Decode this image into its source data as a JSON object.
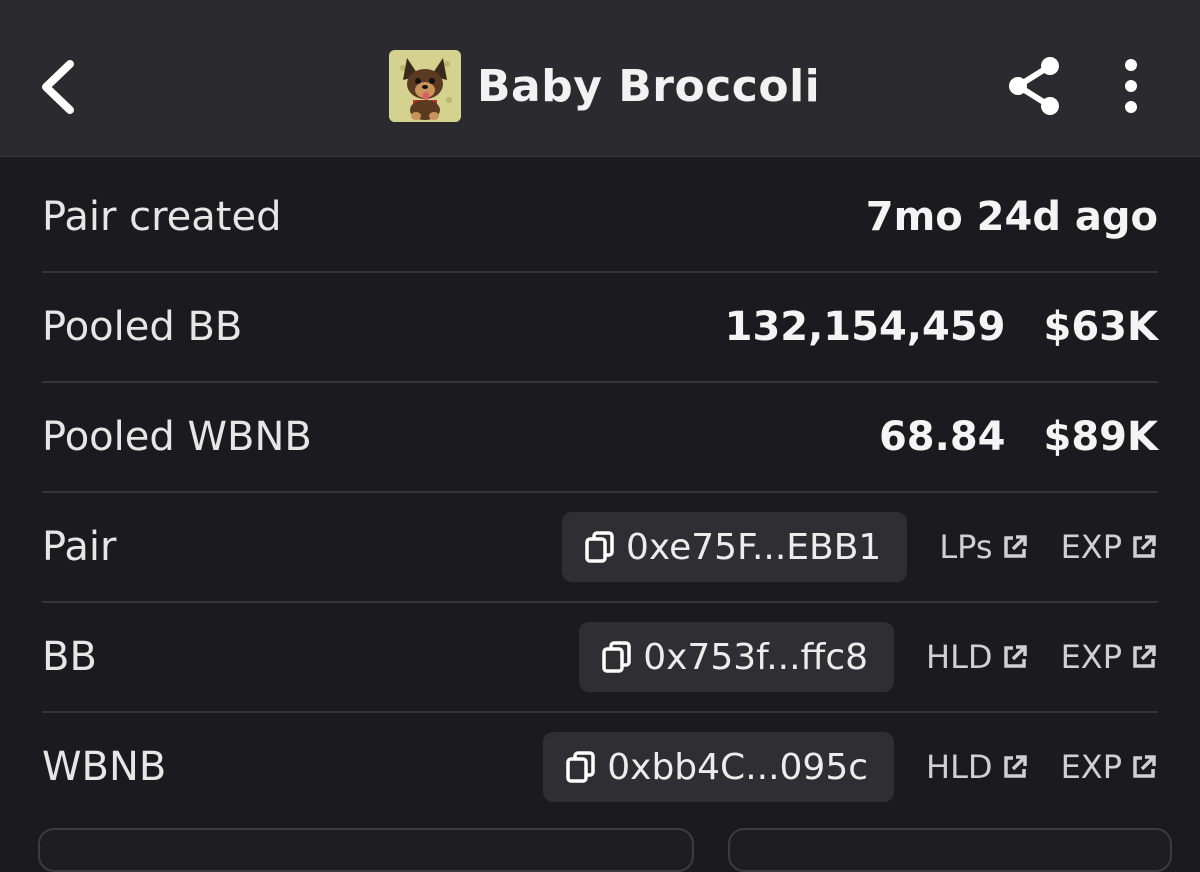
{
  "header": {
    "title": "Baby Broccoli",
    "back_icon": "chevron-left-icon",
    "share_icon": "share-icon",
    "more_icon": "more-vertical-icon"
  },
  "rows": {
    "pair_created": {
      "label": "Pair created",
      "value": "7mo 24d ago"
    },
    "pooled_bb": {
      "label": "Pooled BB",
      "amount": "132,154,459",
      "usd": "$63K"
    },
    "pooled_wbnb": {
      "label": "Pooled WBNB",
      "amount": "68.84",
      "usd": "$89K"
    },
    "pair": {
      "label": "Pair",
      "address": "0xe75F...EBB1",
      "link1": "LPs",
      "link2": "EXP"
    },
    "bb": {
      "label": "BB",
      "address": "0x753f...ffc8",
      "link1": "HLD",
      "link2": "EXP"
    },
    "wbnb": {
      "label": "WBNB",
      "address": "0xbb4C...095c",
      "link1": "HLD",
      "link2": "EXP"
    }
  },
  "colors": {
    "background": "#1b1b1f",
    "header": "#2a2a2f",
    "chip": "#2e2e33",
    "divider": "#34343a"
  }
}
